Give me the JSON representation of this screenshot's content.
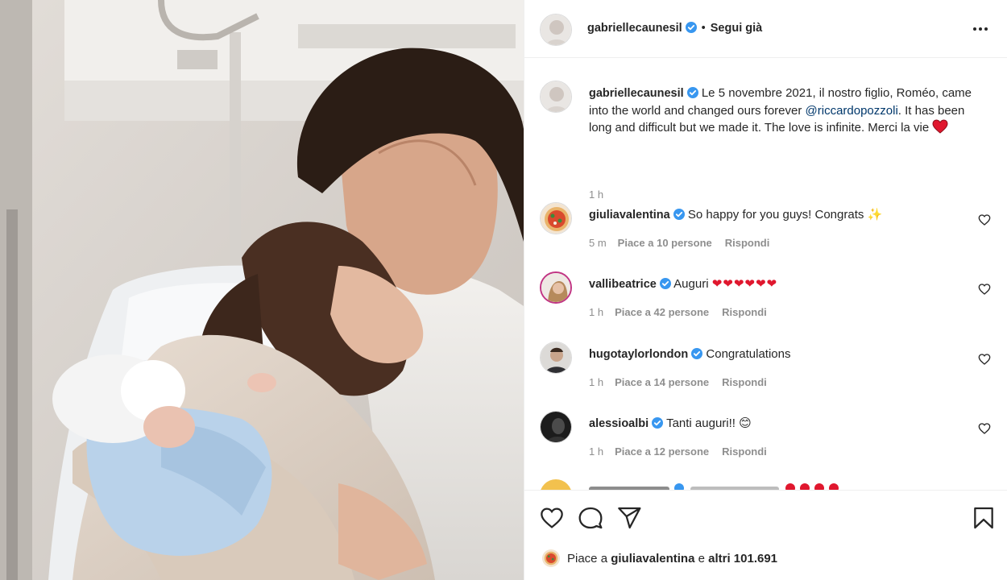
{
  "post": {
    "author": "gabriellecaunesil",
    "separator": "•",
    "follow_label": "Segui già",
    "caption_text": "Le 5 novembre 2021, il nostro figlio, Roméo, came into the world and changed ours forever",
    "caption_mention": "@riccardopozzoli",
    "caption_tail": ". It has been long and difficult but we made it. The love is infinite. Merci la vie",
    "caption_time": "1 h"
  },
  "icons": {
    "more": "more-options-icon",
    "verified": "verified-badge-icon",
    "like": "heart-icon",
    "comment": "comment-icon",
    "share": "share-icon",
    "save": "bookmark-icon"
  },
  "comments": [
    {
      "user": "giuliavalentina",
      "text": "So happy for you guys! Congrats",
      "emoji": "✨",
      "time": "5 m",
      "likes": "Piace a 10 persone",
      "reply": "Rispondi"
    },
    {
      "user": "vallibeatrice",
      "text": "Auguri",
      "emoji": "❤❤❤❤❤❤",
      "time": "1 h",
      "likes": "Piace a 42 persone",
      "reply": "Rispondi"
    },
    {
      "user": "hugotaylorlondon",
      "text": "Congratulations",
      "emoji": "",
      "time": "1 h",
      "likes": "Piace a 14 persone",
      "reply": "Rispondi"
    },
    {
      "user": "alessioalbi",
      "text": "Tanti auguri!!",
      "emoji": "😊",
      "time": "1 h",
      "likes": "Piace a 12 persone",
      "reply": "Rispondi"
    }
  ],
  "likes_line": {
    "prefix": "Piace a",
    "user": "giuliavalentina",
    "middle": "e",
    "others": "altri 101.691"
  },
  "colors": {
    "text": "#262626",
    "muted": "#8e8e8e",
    "link": "#00376b",
    "verified": "#3897f0",
    "heart": "#ed4956",
    "border": "#efefef"
  }
}
